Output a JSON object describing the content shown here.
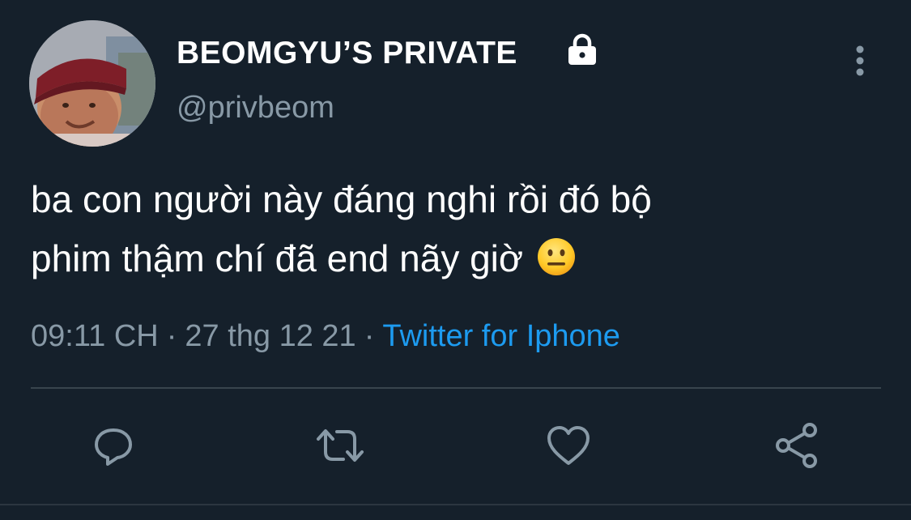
{
  "tweet": {
    "display_name": "BEOMGYU’S PRIVATE",
    "handle": "@privbeom",
    "text_lines": [
      "ba con người này đáng nghi rồi đó bộ",
      "phim thậm chí đã end nãy giờ"
    ],
    "emoji": "neutral-face-emoji",
    "time": "09:11 CH",
    "date": "27 thg 12 21",
    "separator": "·",
    "source": "Twitter for Iphone"
  },
  "icons": {
    "lock": "lock-icon",
    "more": "more-vertical-icon",
    "reply": "reply-icon",
    "retweet": "retweet-icon",
    "like": "heart-icon",
    "share": "share-icon"
  },
  "colors": {
    "background": "#15202b",
    "text": "#ffffff",
    "secondary_text": "#8899a6",
    "link": "#1d9bf0",
    "divider": "#38444d"
  }
}
